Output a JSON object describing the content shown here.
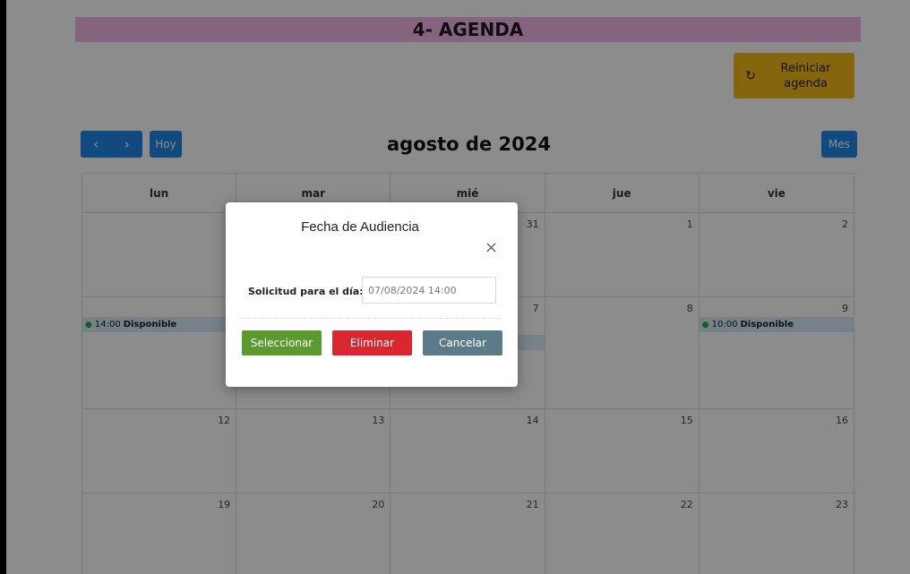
{
  "header": {
    "title": "4- AGENDA"
  },
  "reset_button": {
    "icon": "refresh-icon",
    "label": "Reiniciar agenda"
  },
  "toolbar": {
    "prev": "‹",
    "next": "›",
    "today": "Hoy",
    "title": "agosto de 2024",
    "view": "Mes"
  },
  "calendar": {
    "weekdays": [
      "lun",
      "mar",
      "mié",
      "jue",
      "vie"
    ],
    "weeks": [
      {
        "days": [
          "",
          "",
          "31",
          "1",
          "2"
        ]
      },
      {
        "days": [
          "",
          "",
          "7",
          "8",
          "9"
        ]
      },
      {
        "days": [
          "12",
          "13",
          "14",
          "15",
          "16"
        ]
      },
      {
        "days": [
          "19",
          "20",
          "21",
          "22",
          "23"
        ]
      }
    ],
    "events": [
      {
        "time": "14:00",
        "label": "Disponible"
      },
      {
        "time": "10:00",
        "label": "Disponible"
      }
    ]
  },
  "modal": {
    "title": "Fecha de Audiencia",
    "close": "×",
    "field_label": "Solicitud para el día:",
    "field_value": "07/08/2024 14:00",
    "select_label": "Seleccionar",
    "delete_label": "Eliminar",
    "cancel_label": "Cancelar"
  },
  "colors": {
    "banner": "#f3b6e8",
    "reset": "#f2b91a",
    "primary": "#1e88e5",
    "select": "#5b9a2e",
    "delete": "#d9262f",
    "cancel": "#5c7b89",
    "event_bg": "#d7ebf8"
  }
}
